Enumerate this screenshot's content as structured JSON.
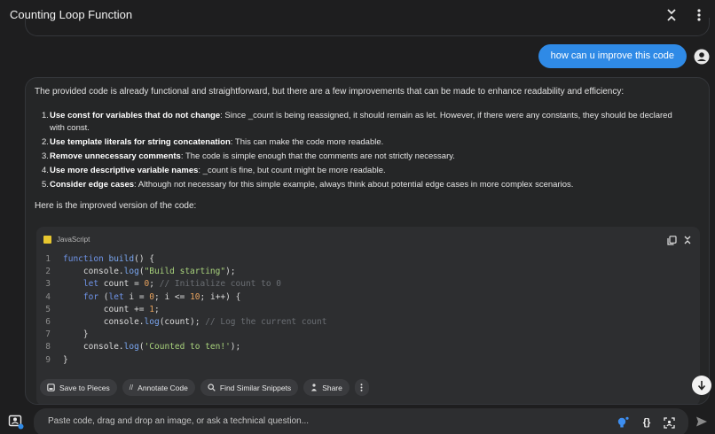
{
  "window": {
    "title": "Counting Loop Function"
  },
  "topbar": {
    "collapse_icon": "collapse-icon",
    "more_icon": "more-vertical-icon"
  },
  "user_message": {
    "text": "how can u improve this code",
    "avatar_icon": "user-avatar-icon"
  },
  "answer": {
    "intro": "The provided code is already functional and straightforward, but there are a few improvements that can be made to enhance readability and efficiency:",
    "items": [
      {
        "num": "1.",
        "title": "Use const for variables that do not change",
        "text": ": Since _count is being reassigned, it should remain as let. However, if there were any constants, they should be declared",
        "text2": "with const."
      },
      {
        "num": "2.",
        "title": "Use template literals for string concatenation",
        "text": ": This can make the code more readable."
      },
      {
        "num": "3.",
        "title": "Remove unnecessary comments",
        "text": ": The code is simple enough that the comments are not strictly necessary."
      },
      {
        "num": "4.",
        "title": "Use more descriptive variable names",
        "text": ": _count is fine, but count might be more readable."
      },
      {
        "num": "5.",
        "title": "Consider edge cases",
        "text": ": Although not necessary for this simple example, always think about potential edge cases in more complex scenarios."
      }
    ],
    "outro": "Here is the improved version of the code:"
  },
  "code_block": {
    "language": "JavaScript",
    "line_numbers": [
      "1",
      "2",
      "3",
      "4",
      "5",
      "6",
      "7",
      "8",
      "9"
    ],
    "lines": [
      {
        "indent": "",
        "parts": [
          [
            "kw",
            "function "
          ],
          [
            "fn",
            "build"
          ],
          [
            "tx",
            "() {"
          ]
        ]
      },
      {
        "indent": "    ",
        "parts": [
          [
            "tx",
            "console."
          ],
          [
            "fn",
            "log"
          ],
          [
            "tx",
            "("
          ],
          [
            "str",
            "\"Build starting\""
          ],
          [
            "tx",
            ");"
          ]
        ]
      },
      {
        "indent": "    ",
        "parts": [
          [
            "kw",
            "let "
          ],
          [
            "tx",
            "count = "
          ],
          [
            "num-t",
            "0"
          ],
          [
            "tx",
            "; "
          ],
          [
            "cm",
            "// Initialize count to 0"
          ]
        ]
      },
      {
        "indent": "    ",
        "parts": [
          [
            "kw",
            "for "
          ],
          [
            "tx",
            "("
          ],
          [
            "kw",
            "let "
          ],
          [
            "tx",
            "i = "
          ],
          [
            "num-t",
            "0"
          ],
          [
            "tx",
            "; i <= "
          ],
          [
            "num-t",
            "10"
          ],
          [
            "tx",
            "; i++) {"
          ]
        ]
      },
      {
        "indent": "        ",
        "parts": [
          [
            "tx",
            "count += "
          ],
          [
            "num-t",
            "1"
          ],
          [
            "tx",
            ";"
          ]
        ]
      },
      {
        "indent": "        ",
        "parts": [
          [
            "tx",
            "console."
          ],
          [
            "fn",
            "log"
          ],
          [
            "tx",
            "(count); "
          ],
          [
            "cm",
            "// Log the current count"
          ]
        ]
      },
      {
        "indent": "    ",
        "parts": [
          [
            "tx",
            "}"
          ]
        ]
      },
      {
        "indent": "    ",
        "parts": [
          [
            "tx",
            "console."
          ],
          [
            "fn",
            "log"
          ],
          [
            "tx",
            "("
          ],
          [
            "str",
            "'Counted to ten!'"
          ],
          [
            "tx",
            ");"
          ]
        ]
      },
      {
        "indent": "",
        "parts": [
          [
            "tx",
            "}"
          ]
        ]
      }
    ],
    "tools": {
      "copy_icon": "copy-icon",
      "collapse_icon": "collapse-code-icon"
    }
  },
  "actions": [
    {
      "label": "Save to Pieces",
      "icon": "save-icon"
    },
    {
      "label": "Annotate Code",
      "icon": "annotate-icon"
    },
    {
      "label": "Find Similar Snippets",
      "icon": "search-icon"
    },
    {
      "label": "Share",
      "icon": "share-icon"
    }
  ],
  "composer": {
    "placeholder": "Paste code, drag and drop an image, or ask a technical question...",
    "tools": [
      "lightbulb-icon",
      "code-braces-icon",
      "screenshot-icon"
    ],
    "send_icon": "send-icon"
  },
  "colors": {
    "accent": "#2f8ae6",
    "background": "#1e1e1f",
    "card": "#252627",
    "code_bg": "#2d2e30"
  }
}
